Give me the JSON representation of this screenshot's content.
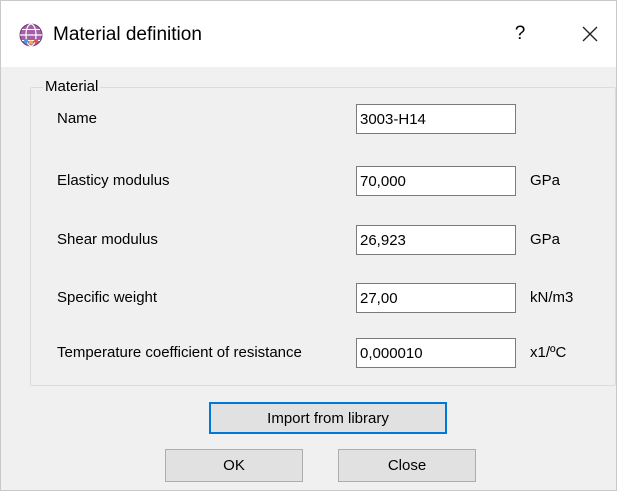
{
  "window": {
    "title": "Material definition",
    "help_label": "?",
    "icon": "globe-app-icon",
    "close_icon": "close-icon"
  },
  "material": {
    "group_label": "Material",
    "fields": [
      {
        "label": "Name",
        "value": "3003-H14",
        "unit": ""
      },
      {
        "label": "Elasticy modulus",
        "value": "70,000",
        "unit": "GPa"
      },
      {
        "label": "Shear modulus",
        "value": "26,923",
        "unit": "GPa"
      },
      {
        "label": "Specific weight",
        "value": "27,00",
        "unit": "kN/m3"
      },
      {
        "label": "Temperature coefficient of resistance",
        "value": "0,000010",
        "unit": "x1/ºC"
      }
    ]
  },
  "buttons": {
    "import_label": "Import from library",
    "ok_label": "OK",
    "close_label": "Close"
  },
  "colors": {
    "dialog_background": "#f0f0f0",
    "focus_accent": "#0078d7",
    "button_face": "#e1e1e1"
  }
}
